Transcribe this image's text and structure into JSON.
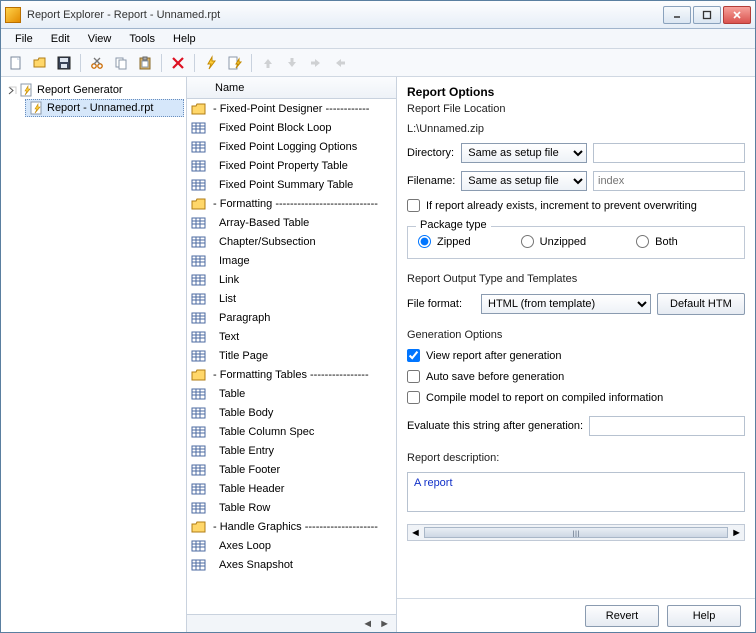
{
  "window": {
    "title": "Report Explorer - Report - Unnamed.rpt"
  },
  "menu": {
    "items": [
      "File",
      "Edit",
      "View",
      "Tools",
      "Help"
    ]
  },
  "toolbar_icons": [
    "new",
    "open",
    "save",
    "|",
    "cut",
    "copy",
    "paste",
    "|",
    "delete",
    "|",
    "bolt",
    "bolt2",
    "|",
    "up",
    "down",
    "right",
    "left"
  ],
  "tree": {
    "root": {
      "label": "Report Generator"
    },
    "child": {
      "label": "Report - Unnamed.rpt"
    }
  },
  "mid": {
    "header": "Name",
    "items": [
      {
        "t": "folder",
        "label": " - Fixed-Point Designer  ------------"
      },
      {
        "t": "item",
        "label": "Fixed Point Block Loop"
      },
      {
        "t": "item",
        "label": "Fixed Point Logging Options"
      },
      {
        "t": "item",
        "label": "Fixed Point Property Table"
      },
      {
        "t": "item",
        "label": "Fixed Point Summary Table"
      },
      {
        "t": "folder",
        "label": " - Formatting  ----------------------------"
      },
      {
        "t": "item",
        "label": "Array-Based Table"
      },
      {
        "t": "item",
        "label": "Chapter/Subsection"
      },
      {
        "t": "item",
        "label": "Image"
      },
      {
        "t": "item",
        "label": "Link"
      },
      {
        "t": "item",
        "label": "List"
      },
      {
        "t": "item",
        "label": "Paragraph"
      },
      {
        "t": "item",
        "label": "Text"
      },
      {
        "t": "item",
        "label": "Title Page"
      },
      {
        "t": "folder",
        "label": " - Formatting Tables  ----------------"
      },
      {
        "t": "item",
        "label": "Table"
      },
      {
        "t": "item",
        "label": "Table Body"
      },
      {
        "t": "item",
        "label": "Table Column Spec"
      },
      {
        "t": "item",
        "label": "Table Entry"
      },
      {
        "t": "item",
        "label": "Table Footer"
      },
      {
        "t": "item",
        "label": "Table Header"
      },
      {
        "t": "item",
        "label": "Table Row"
      },
      {
        "t": "folder",
        "label": " - Handle Graphics  --------------------"
      },
      {
        "t": "item",
        "label": "Axes Loop"
      },
      {
        "t": "item",
        "label": "Axes Snapshot"
      }
    ]
  },
  "options": {
    "heading": "Report Options",
    "file_loc_label": "Report File Location",
    "file_path": "L:\\Unnamed.zip",
    "directory_label": "Directory:",
    "directory_value": "Same as setup file",
    "filename_label": "Filename:",
    "filename_value": "Same as setup file",
    "filename_input_placeholder": "index",
    "increment_label": "If report already exists, increment to prevent overwriting",
    "package_legend": "Package type",
    "package_opts": [
      "Zipped",
      "Unzipped",
      "Both"
    ],
    "package_selected": "Zipped",
    "output_section": "Report Output Type and Templates",
    "fileformat_label": "File format:",
    "fileformat_value": "HTML (from template)",
    "default_btn": "Default HTM",
    "gen_section": "Generation Options",
    "gen_view": "View report after generation",
    "gen_autosave": "Auto save before generation",
    "gen_compile": "Compile model to report on compiled information",
    "eval_label": "Evaluate this string after generation:",
    "desc_label": "Report description:",
    "desc_value": "A report",
    "footer": {
      "revert": "Revert",
      "help": "Help"
    },
    "scroll_marker": "III"
  }
}
